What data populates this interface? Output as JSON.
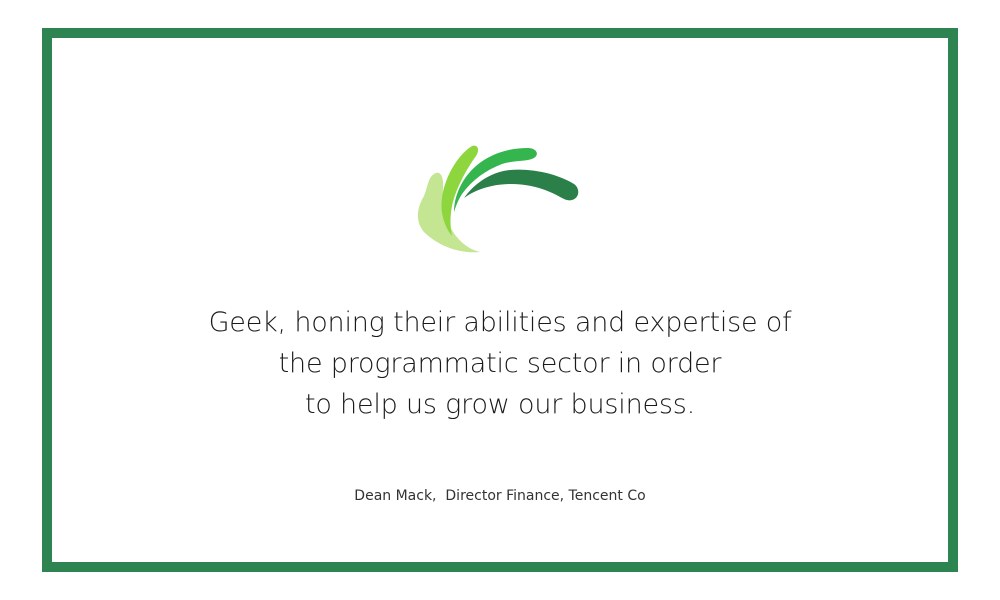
{
  "quote": {
    "lines": [
      "Geek, honing their abilities and expertise of",
      "the programmatic sector in order",
      "to help us grow our business."
    ]
  },
  "attribution": "Dean Mack,  Director Finance, Tencent Co",
  "colors": {
    "border": "#2e8450",
    "logo_dark": "#2a8048",
    "logo_mid": "#34b54e",
    "logo_light": "#8ed63e",
    "logo_pale": "#c4e592"
  },
  "icons": {
    "logo": "green-swoosh-logo-icon"
  }
}
